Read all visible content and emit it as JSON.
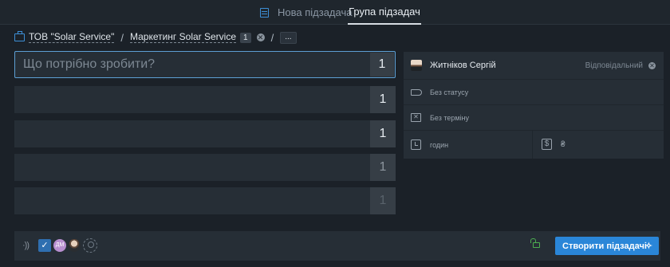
{
  "tabs": {
    "new_subtask": "Нова підзадача",
    "subtask_group": "Група підзадач"
  },
  "breadcrumb": {
    "client": "ТОВ \"Solar Service\"",
    "separator": "/",
    "project": "Маркетинг Solar Service",
    "project_count": "1",
    "more": "..."
  },
  "tasks": {
    "placeholder": "Що потрібно зробити?",
    "rows": [
      {
        "value": "",
        "count": "1"
      },
      {
        "value": "",
        "count": "1"
      },
      {
        "value": "",
        "count": "1"
      },
      {
        "value": "",
        "count": "1"
      },
      {
        "value": "",
        "count": "1"
      }
    ]
  },
  "panel": {
    "responsible_name": "Житніков Сергій",
    "responsible_role": "Відповідальний",
    "status": "Без статусу",
    "deadline": "Без терміну",
    "hours_label": "годин",
    "currency": "₴"
  },
  "bottom": {
    "participant_initials": "ДМ",
    "create_button": "Створити підзадачі"
  },
  "colors": {
    "accent": "#2a86d8",
    "active_border": "#5d9fd4",
    "background": "#1b2128",
    "panel": "#262e36",
    "lock": "#4caf50"
  },
  "icons": [
    "tasks-icon",
    "briefcase-icon",
    "tag-icon",
    "calendar-icon",
    "clock-icon",
    "dollar-icon",
    "wave-icon",
    "check-icon",
    "add-user-icon",
    "unlock-icon",
    "sparkle-icon"
  ]
}
